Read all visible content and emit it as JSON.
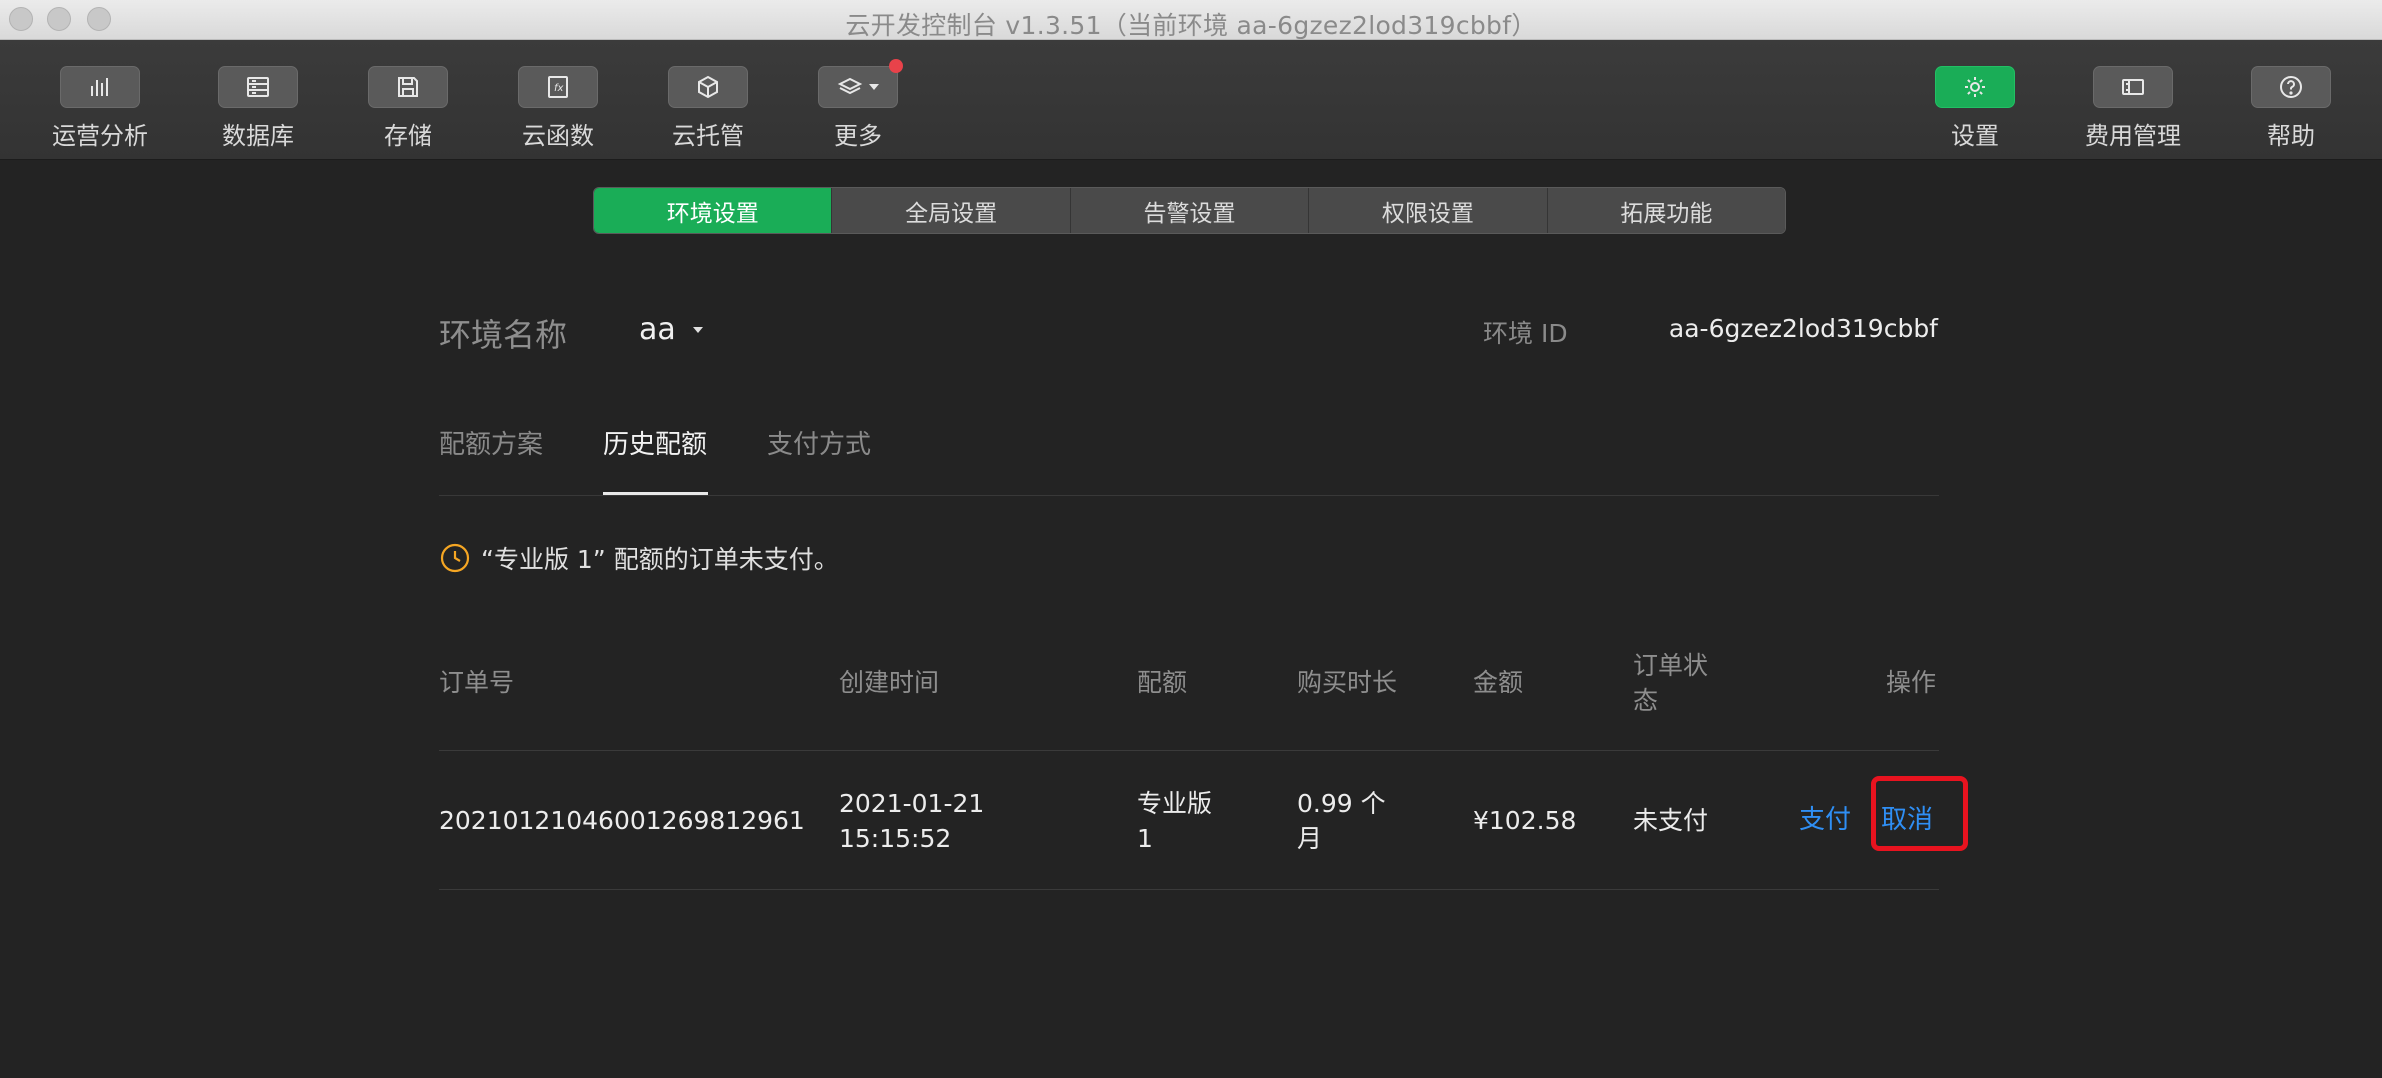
{
  "window": {
    "title": "云开发控制台 v1.3.51（当前环境 aa-6gzez2lod319cbbf）"
  },
  "toolbar": {
    "items": [
      {
        "label": "运营分析",
        "icon": "bar-chart-icon"
      },
      {
        "label": "数据库",
        "icon": "database-icon"
      },
      {
        "label": "存储",
        "icon": "save-icon"
      },
      {
        "label": "云函数",
        "icon": "function-icon"
      },
      {
        "label": "云托管",
        "icon": "cube-icon"
      },
      {
        "label": "更多",
        "icon": "layers-icon"
      },
      {
        "label": "设置",
        "icon": "gear-icon"
      },
      {
        "label": "费用管理",
        "icon": "wallet-icon"
      },
      {
        "label": "帮助",
        "icon": "help-icon"
      }
    ],
    "accent": "#1aad57",
    "badge_color": "#e8424a"
  },
  "segtabs": {
    "items": [
      "环境设置",
      "全局设置",
      "告警设置",
      "权限设置",
      "拓展功能"
    ],
    "active": 0
  },
  "env": {
    "name_label": "环境名称",
    "name_value": "aa",
    "id_label": "环境 ID",
    "id_value": "aa-6gzez2lod319cbbf"
  },
  "subtabs": {
    "items": [
      "配额方案",
      "历史配额",
      "支付方式"
    ],
    "active": 1
  },
  "notice": {
    "text": "“专业版 1” 配额的订单未支付。",
    "icon": "clock-icon",
    "color": "#f5a623"
  },
  "table": {
    "headers": {
      "order_no": "订单号",
      "created": "创建时间",
      "quota": "配额",
      "duration": "购买时长",
      "amount": "金额",
      "status": "订单状态",
      "actions": "操作"
    },
    "rows": [
      {
        "order_no": "2021012104600126981296​1",
        "created_date": "2021-01-21",
        "created_time": "15:15:52",
        "quota": "专业版 1",
        "duration": "0.99 个月",
        "amount": "¥102.58",
        "status": "未支付",
        "action_pay": "支付",
        "action_cancel": "取消"
      }
    ],
    "link_color": "#2f8ff5",
    "highlight_color": "#e8131f"
  }
}
